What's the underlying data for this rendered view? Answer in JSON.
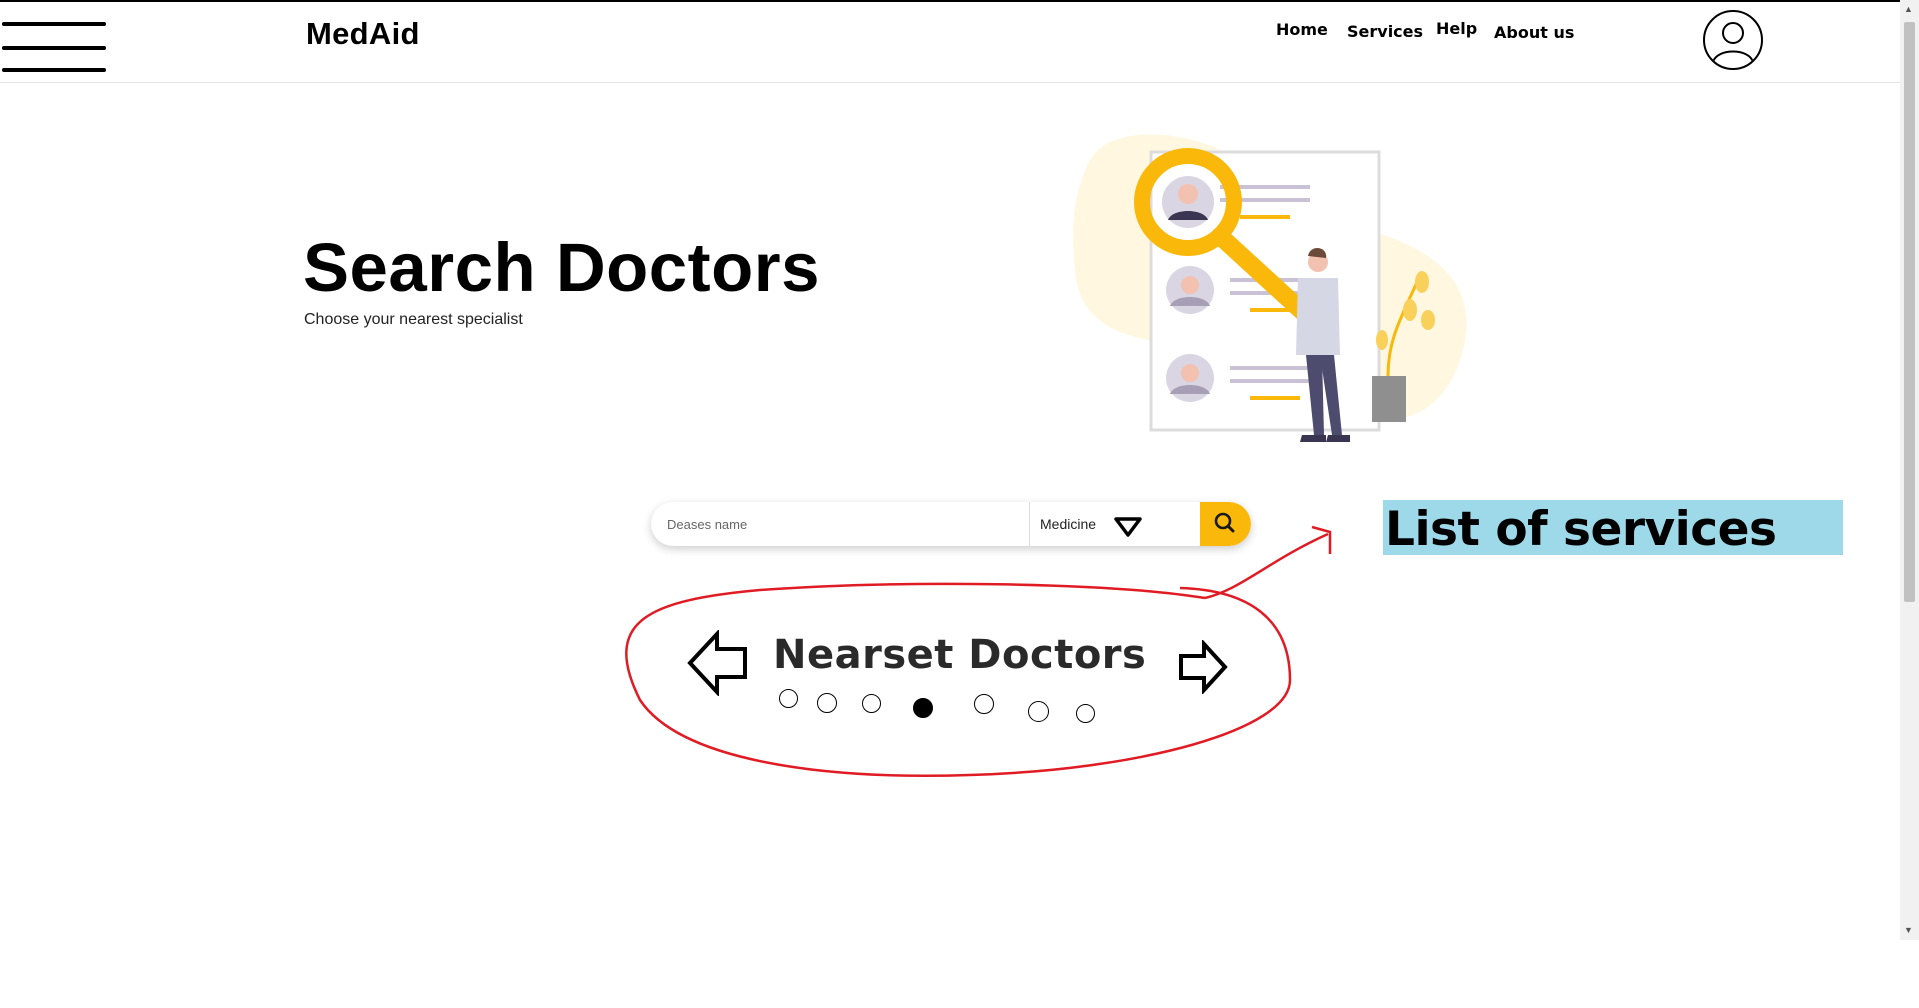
{
  "navbar": {
    "brand": "MedAid",
    "links": [
      "Home",
      "Services",
      "Help",
      "About us"
    ]
  },
  "hero": {
    "title": "Search Doctors",
    "subtitle": "Choose your nearest specialist"
  },
  "search": {
    "placeholder": "Deases name",
    "category_selected": "Medicine"
  },
  "annotation": {
    "label": "List of services"
  },
  "nearest": {
    "title": "Nearset Doctors",
    "dots_count": 7,
    "active_dot": 4
  },
  "colors": {
    "accent": "#f9b80a",
    "annotation_bg": "#9dd9e8",
    "annotation_stroke": "#e01b24"
  },
  "icons": {
    "menu": "hamburger-icon",
    "profile": "user-circle-icon",
    "search": "search-icon",
    "dropdown": "triangle-down-icon",
    "prev": "arrow-left-icon",
    "next": "arrow-right-icon"
  }
}
